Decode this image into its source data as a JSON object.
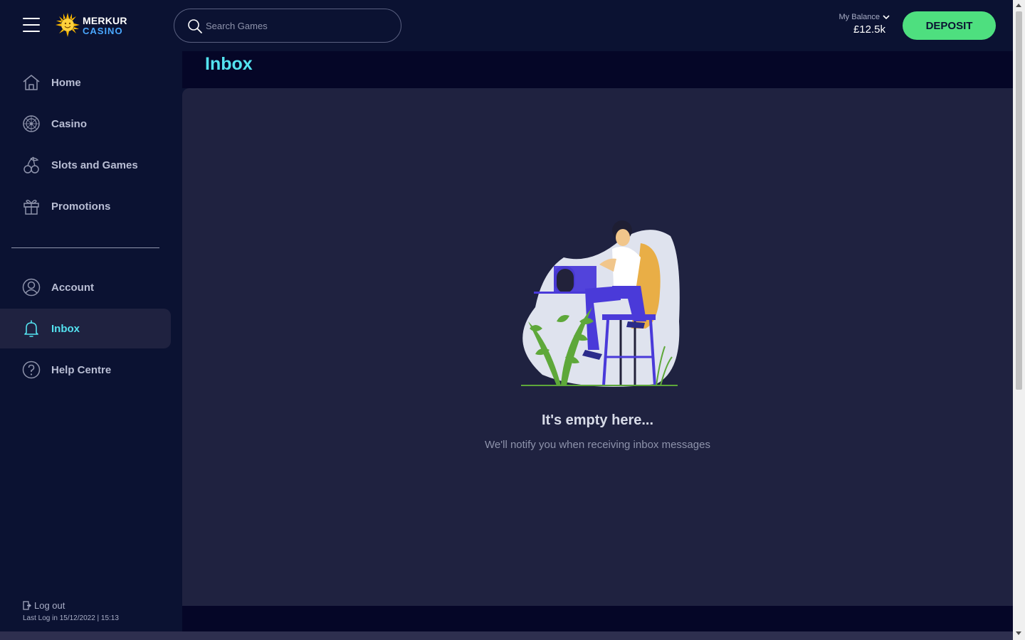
{
  "brand": {
    "name_line1": "MERKUR",
    "name_line2": "CASINO"
  },
  "search": {
    "placeholder": "Search Games"
  },
  "balance": {
    "label": "My Balance",
    "value": "£12.5k"
  },
  "deposit_label": "DEPOSIT",
  "sidebar": {
    "items": [
      {
        "label": "Home",
        "icon": "home-icon"
      },
      {
        "label": "Casino",
        "icon": "roulette-icon"
      },
      {
        "label": "Slots and Games",
        "icon": "cherries-icon"
      },
      {
        "label": "Promotions",
        "icon": "gift-icon"
      },
      {
        "label": "Account",
        "icon": "user-icon"
      },
      {
        "label": "Inbox",
        "icon": "bell-icon",
        "active": true
      },
      {
        "label": "Help Centre",
        "icon": "help-icon"
      }
    ],
    "logout_label": "Log out",
    "last_login": "Last Log in 15/12/2022 | 15:13"
  },
  "page": {
    "title": "Inbox",
    "empty_title": "It's empty here...",
    "empty_subtitle": "We'll notify you when receiving inbox messages"
  },
  "colors": {
    "background": "#0b1232",
    "panel": "#1f2240",
    "accent_cyan": "#54e3f0",
    "deposit_green": "#4edf7f"
  }
}
